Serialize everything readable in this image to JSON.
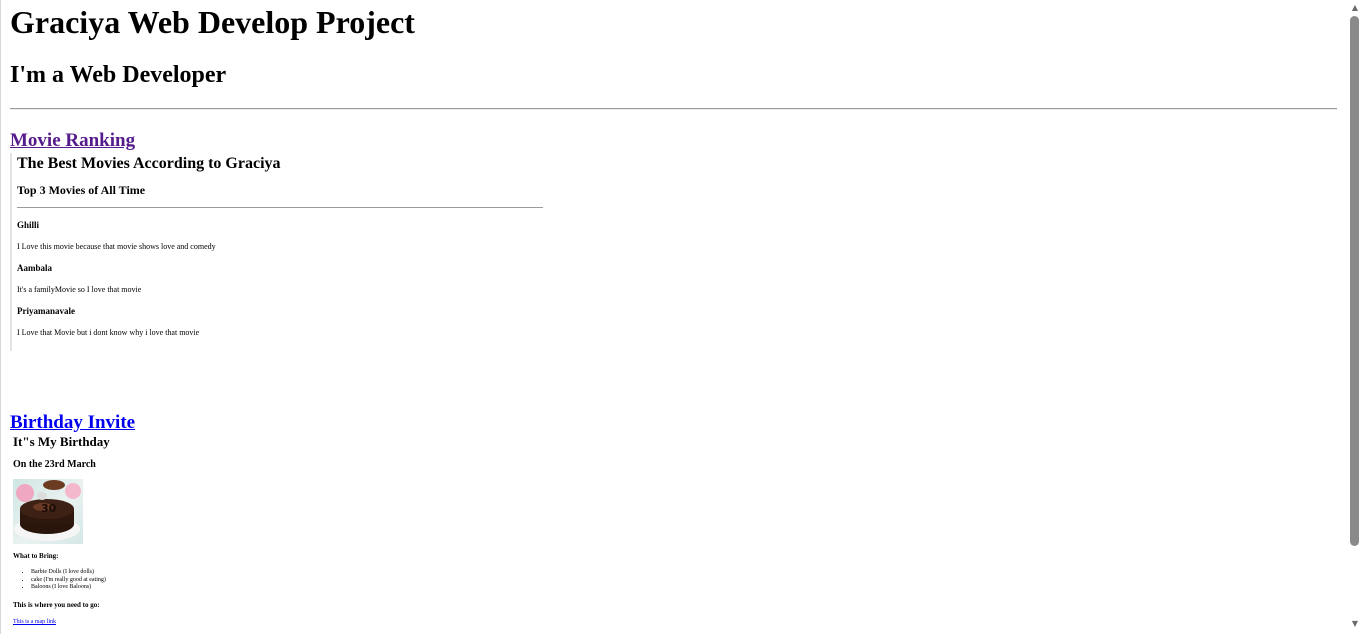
{
  "header": {
    "title": "Graciya Web Develop Project",
    "subtitle": "I'm a Web Developer"
  },
  "movie_section": {
    "link_label": "Movie Ranking",
    "frame": {
      "title": "The Best Movies According to Graciya",
      "subtitle": "Top 3 Movies of All Time",
      "movies": [
        {
          "name": "Ghilli",
          "description": "I Love this movie because that movie shows love and comedy"
        },
        {
          "name": "Aambala",
          "description": "It's a familyMovie so I love that movie"
        },
        {
          "name": "Priyamanavale",
          "description": "I Love that Movie but i dont know why i love that movie"
        }
      ]
    }
  },
  "birthday_section": {
    "link_label": "Birthday Invite",
    "frame": {
      "title": "It\"s My Birthday",
      "date": "On the 23rd March",
      "bring_heading": "What to Bring:",
      "bring_items": [
        "Barbie Dolls (I love dolls)",
        "cake (I'm really good at eating)",
        "Baloons (I love Baloons)"
      ],
      "location_heading": "This is where you need to go:",
      "map_link": "This is a map link"
    }
  },
  "colors": {
    "visited_link": "#551a8b",
    "unvisited_link": "#0000ee",
    "scroll_thumb": "#8a8a8a"
  }
}
